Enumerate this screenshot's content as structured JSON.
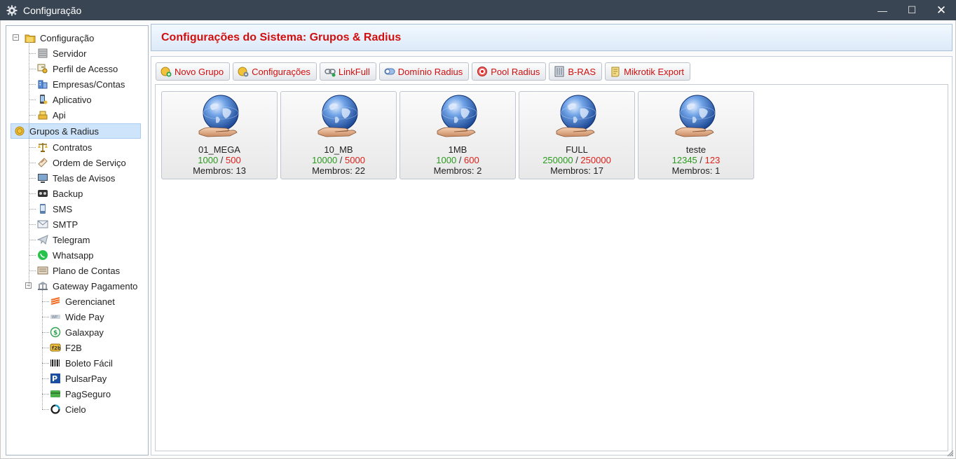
{
  "window": {
    "title": "Configuração",
    "minimize_label": "—",
    "maximize_label": "☐",
    "close_label": "✕"
  },
  "sidebar": {
    "root_label": "Configuração",
    "items": [
      {
        "label": "Servidor",
        "icon": "server-icon"
      },
      {
        "label": "Perfil de Acesso",
        "icon": "key-icon"
      },
      {
        "label": "Empresas/Contas",
        "icon": "building-icon"
      },
      {
        "label": "Aplicativo",
        "icon": "mobile-icon"
      },
      {
        "label": "Api",
        "icon": "api-icon"
      },
      {
        "label": "Grupos & Radius",
        "icon": "coin-icon",
        "selected": true
      },
      {
        "label": "Contratos",
        "icon": "scale-icon"
      },
      {
        "label": "Ordem de Serviço",
        "icon": "ticket-icon"
      },
      {
        "label": "Telas de Avisos",
        "icon": "monitor-icon"
      },
      {
        "label": "Backup",
        "icon": "backup-icon"
      },
      {
        "label": "SMS",
        "icon": "phone-icon"
      },
      {
        "label": "SMTP",
        "icon": "mail-icon"
      },
      {
        "label": "Telegram",
        "icon": "telegram-icon"
      },
      {
        "label": "Whatsapp",
        "icon": "whatsapp-icon"
      },
      {
        "label": "Plano de Contas",
        "icon": "ledger-icon"
      }
    ],
    "gateway_label": "Gateway Pagamento",
    "gateway_items": [
      {
        "label": "Gerencianet",
        "icon": "gerencianet-icon"
      },
      {
        "label": "Wide Pay",
        "icon": "widepay-icon"
      },
      {
        "label": "Galaxpay",
        "icon": "galaxpay-icon"
      },
      {
        "label": "F2B",
        "icon": "f2b-icon"
      },
      {
        "label": "Boleto Fácil",
        "icon": "barcode-icon"
      },
      {
        "label": "PulsarPay",
        "icon": "pulsarpay-icon"
      },
      {
        "label": "PagSeguro",
        "icon": "pagseguro-icon"
      },
      {
        "label": "Cielo",
        "icon": "cielo-icon"
      }
    ]
  },
  "header": {
    "title": "Configurações do Sistema: Grupos & Radius"
  },
  "toolbar": {
    "buttons": [
      {
        "label": "Novo Grupo",
        "icon": "add-coin-icon"
      },
      {
        "label": "Configurações",
        "icon": "settings-coin-icon"
      },
      {
        "label": "LinkFull",
        "icon": "link-icon"
      },
      {
        "label": "Domínio Radius",
        "icon": "toggle-icon"
      },
      {
        "label": "Pool Radius",
        "icon": "target-icon"
      },
      {
        "label": "B-RAS",
        "icon": "rack-icon"
      },
      {
        "label": "Mikrotik Export",
        "icon": "scroll-icon"
      }
    ]
  },
  "groups": [
    {
      "name": "01_MEGA",
      "download": "1000",
      "upload": "500",
      "separator": " / ",
      "members": "Membros: 13"
    },
    {
      "name": "10_MB",
      "download": "10000",
      "upload": "5000",
      "separator": " / ",
      "members": "Membros: 22"
    },
    {
      "name": "1MB",
      "download": "1000",
      "upload": "600",
      "separator": " / ",
      "members": "Membros: 2"
    },
    {
      "name": "FULL",
      "download": "250000",
      "upload": "250000",
      "separator": " / ",
      "members": "Membros: 17"
    },
    {
      "name": "teste",
      "download": "12345",
      "upload": "123",
      "separator": " / ",
      "members": "Membros: 1"
    }
  ],
  "colors": {
    "titlebar": "#3a4553",
    "header_title": "#d10f0f",
    "download": "#2a9a1e",
    "upload": "#e0201a",
    "selected_row": "#cde4fb"
  }
}
